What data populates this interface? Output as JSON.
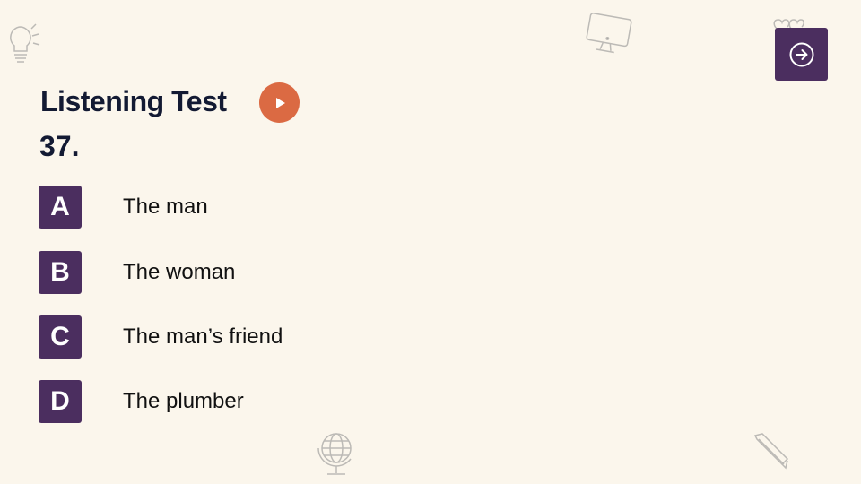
{
  "header": {
    "title": "Listening Test",
    "question_number": "37."
  },
  "controls": {
    "play_icon": "play-icon",
    "next_icon": "arrow-right-circle-icon"
  },
  "options": [
    {
      "letter": "A",
      "text": "The man"
    },
    {
      "letter": "B",
      "text": "The woman"
    },
    {
      "letter": "C",
      "text": "The man’s friend"
    },
    {
      "letter": "D",
      "text": "The plumber"
    }
  ],
  "decorations": [
    "lightbulb-icon",
    "monitor-icon",
    "heart-icon",
    "globe-icon",
    "pencil-icon"
  ],
  "colors": {
    "background": "#fbf6ec",
    "title": "#131a33",
    "accent_purple": "#4b2e5f",
    "play_orange": "#db6a43"
  }
}
